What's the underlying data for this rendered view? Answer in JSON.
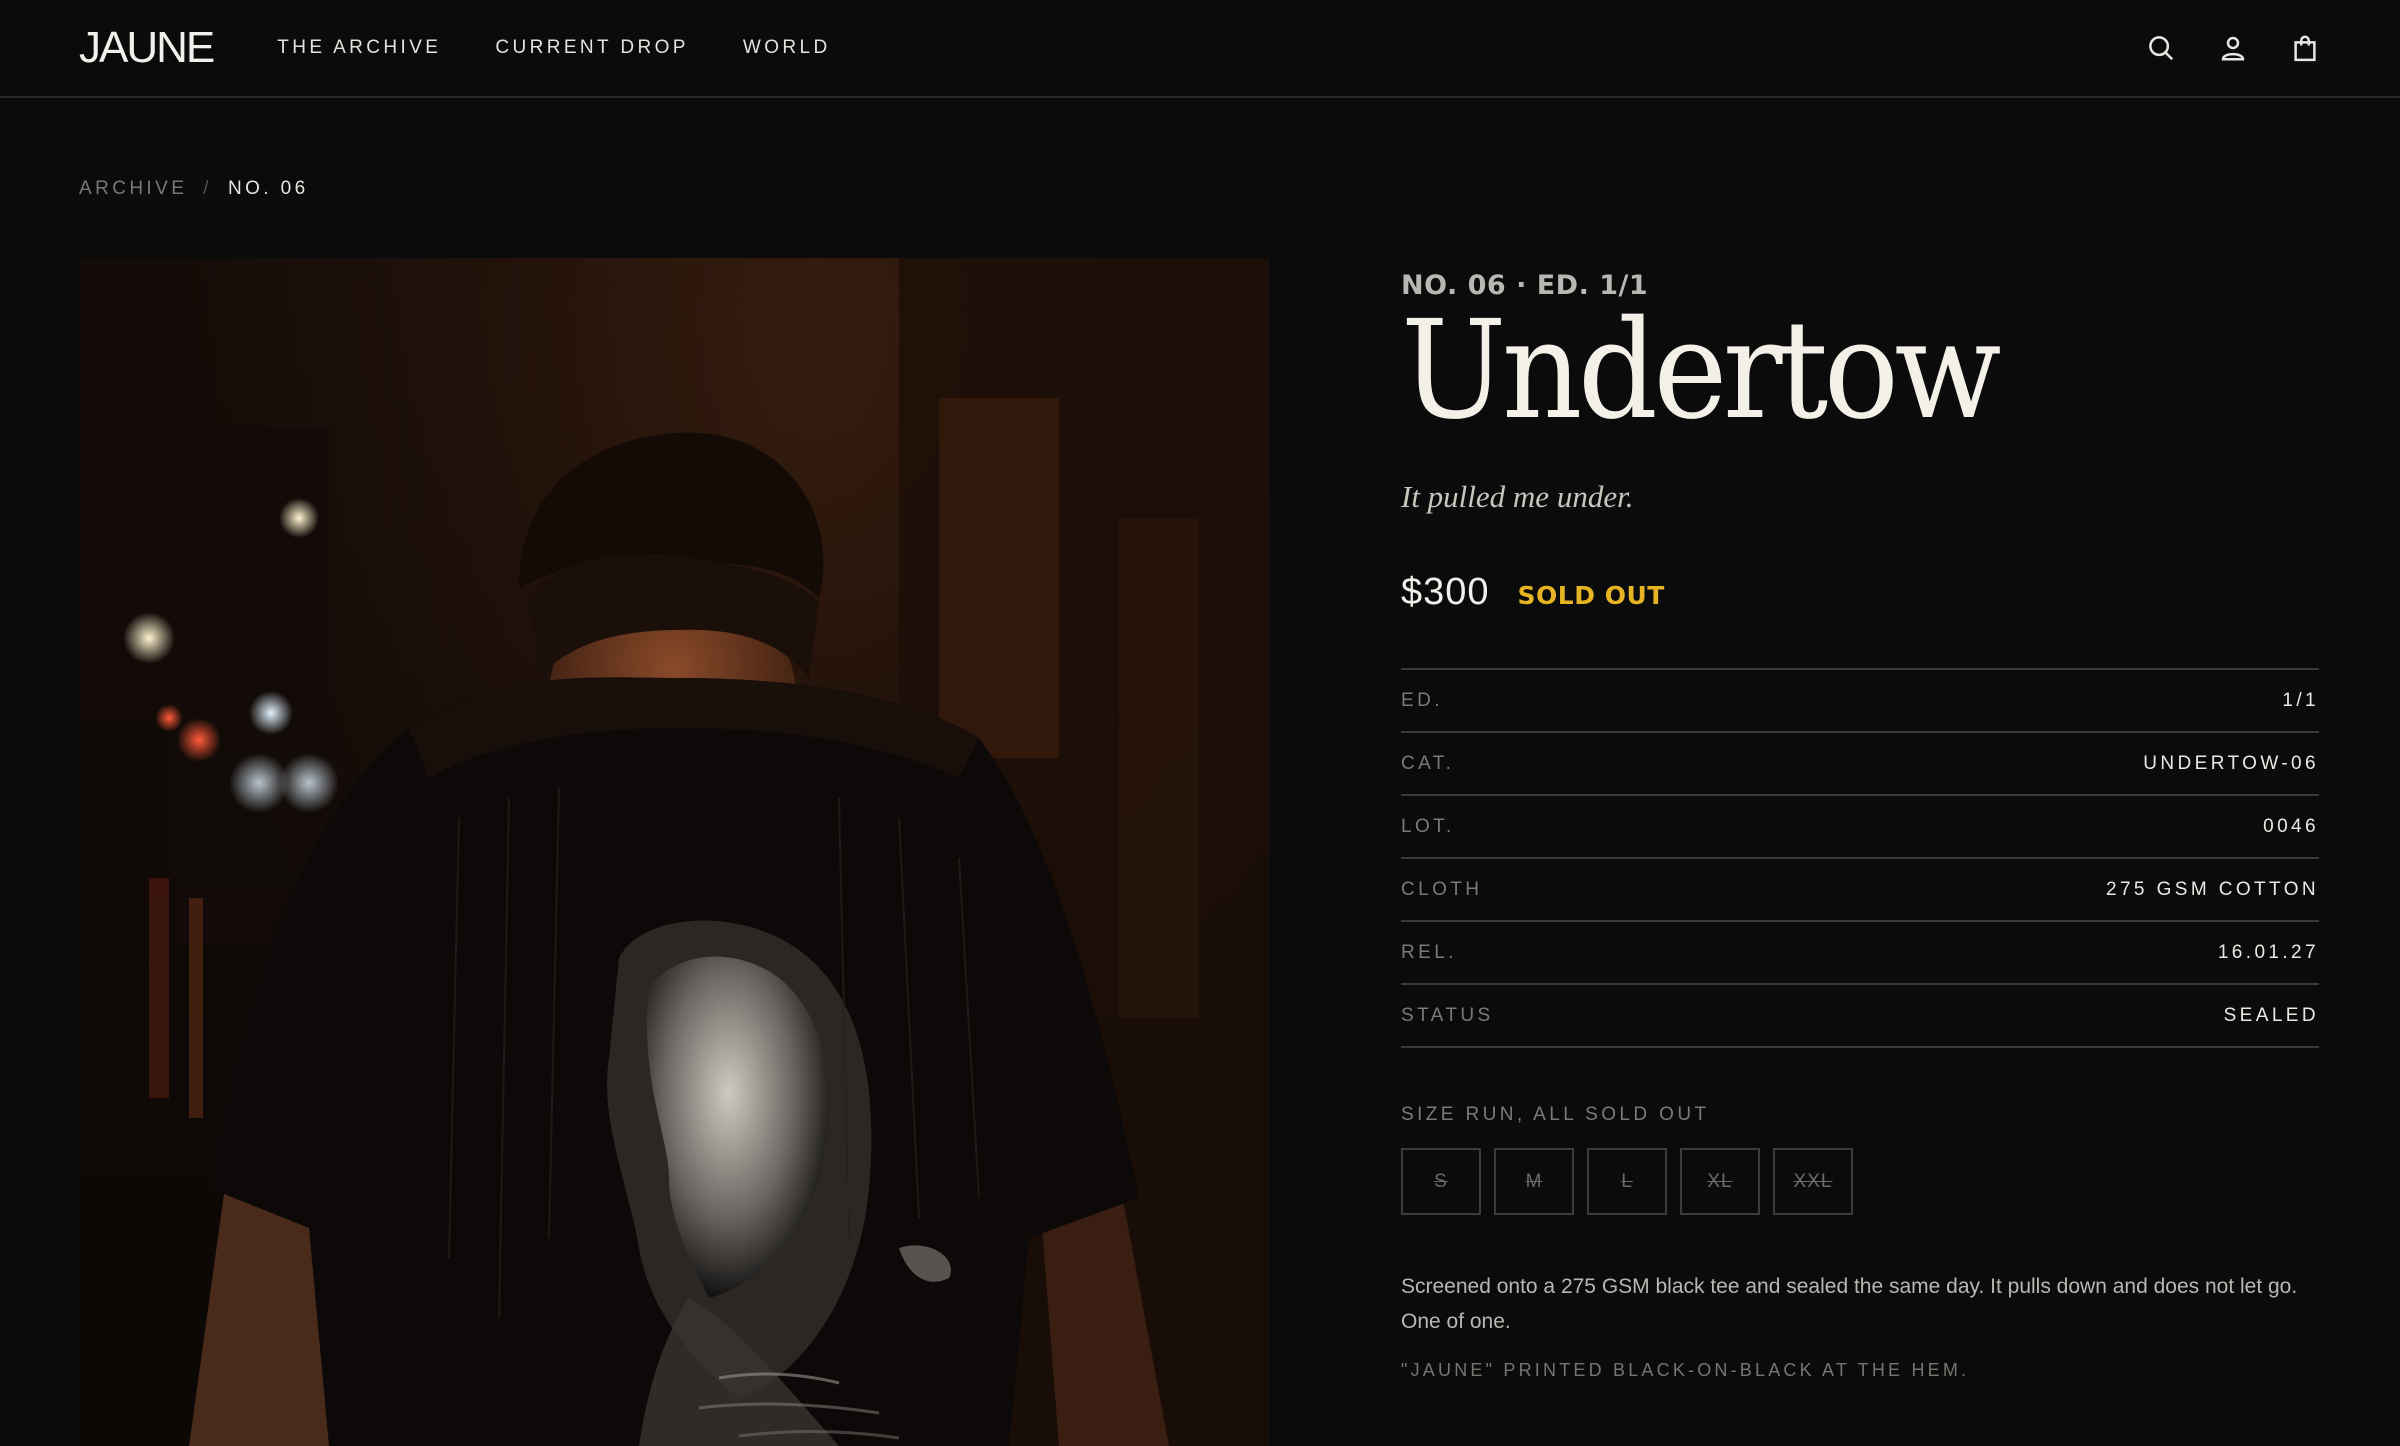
{
  "header": {
    "logo": "JAUNE",
    "nav": [
      "THE ARCHIVE",
      "CURRENT DROP",
      "WORLD"
    ],
    "icons": [
      "search-icon",
      "account-icon",
      "cart-icon"
    ]
  },
  "breadcrumb": {
    "parent": "ARCHIVE",
    "separator": "/",
    "current": "NO. 06"
  },
  "product": {
    "edition_tag": "NO. 06 · ED. 1/1",
    "title": "Undertow",
    "tagline": "It pulled me under.",
    "price": "$300",
    "badge": "SOLD OUT",
    "badge_color": "#e6b422",
    "specs": [
      {
        "key": "ED.",
        "value": "1/1"
      },
      {
        "key": "CAT.",
        "value": "UNDERTOW-06"
      },
      {
        "key": "LOT.",
        "value": "0046"
      },
      {
        "key": "CLOTH",
        "value": "275 GSM COTTON"
      },
      {
        "key": "REL.",
        "value": "16.01.27"
      },
      {
        "key": "STATUS",
        "value": "SEALED"
      }
    ],
    "size_label": "SIZE RUN, ALL SOLD OUT",
    "sizes": [
      "S",
      "M",
      "L",
      "XL",
      "XXL"
    ],
    "description": "Screened onto a 275 GSM black tee and sealed the same day. It pulls down and does not let go. One of one.",
    "hem_note": "\"JAUNE\" PRINTED BLACK-ON-BLACK AT THE HEM."
  },
  "colors": {
    "background": "#0b0b0c",
    "accent": "#e6b422"
  }
}
